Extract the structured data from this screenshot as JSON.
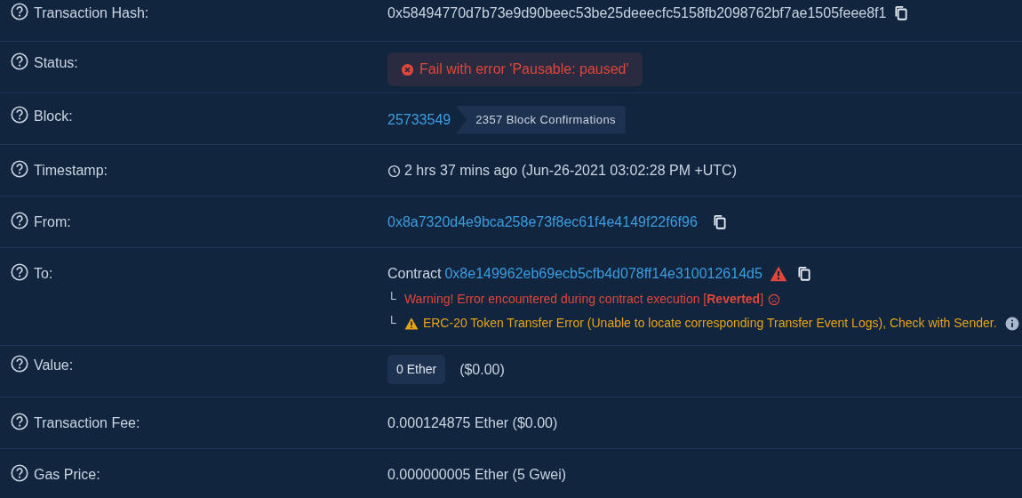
{
  "rows": [
    {
      "label": "Transaction Hash:",
      "kind": "copy",
      "text": "0x58494770d7b73e9d90beec53be25deeecfc5158fb2098762bf7ae1505feee8f1"
    },
    {
      "label": "Status:",
      "kind": "status",
      "text": "Fail with error 'Pausable: paused'"
    },
    {
      "label": "Block:",
      "kind": "block",
      "link": "25733549",
      "badge": "2357 Block Confirmations"
    },
    {
      "label": "Timestamp:",
      "kind": "time",
      "text": "2 hrs 37 mins ago (Jun-26-2021 03:02:28 PM +UTC)"
    },
    {
      "label": "From:",
      "kind": "address",
      "link": "0x8a7320d4e9bca258e73f8ec61f4e4149f22f6f96"
    },
    {
      "label": "To:",
      "kind": "contract",
      "prefix": "Contract",
      "link": "0x8e149962eb69ecb5cfb4d078ff14e310012614d5",
      "notes": [
        {
          "kind": "error",
          "branch": "└",
          "text": "Warning! Error encountered during contract execution [**Reverted**]"
        },
        {
          "kind": "warning",
          "branch": "└",
          "text": "ERC-20 Token Transfer Error (Unable to locate corresponding Transfer Event Logs), Check with Sender."
        }
      ]
    },
    {
      "label": "Value:",
      "kind": "amount",
      "badge": "0 Ether",
      "text": "($0.00)"
    },
    {
      "label": "Transaction Fee:",
      "kind": "text",
      "text": "0.000124875 Ether ($0.00)"
    },
    {
      "label": "Gas Price:",
      "kind": "text",
      "text": "0.000000005 Ether (5 Gwei)"
    }
  ]
}
